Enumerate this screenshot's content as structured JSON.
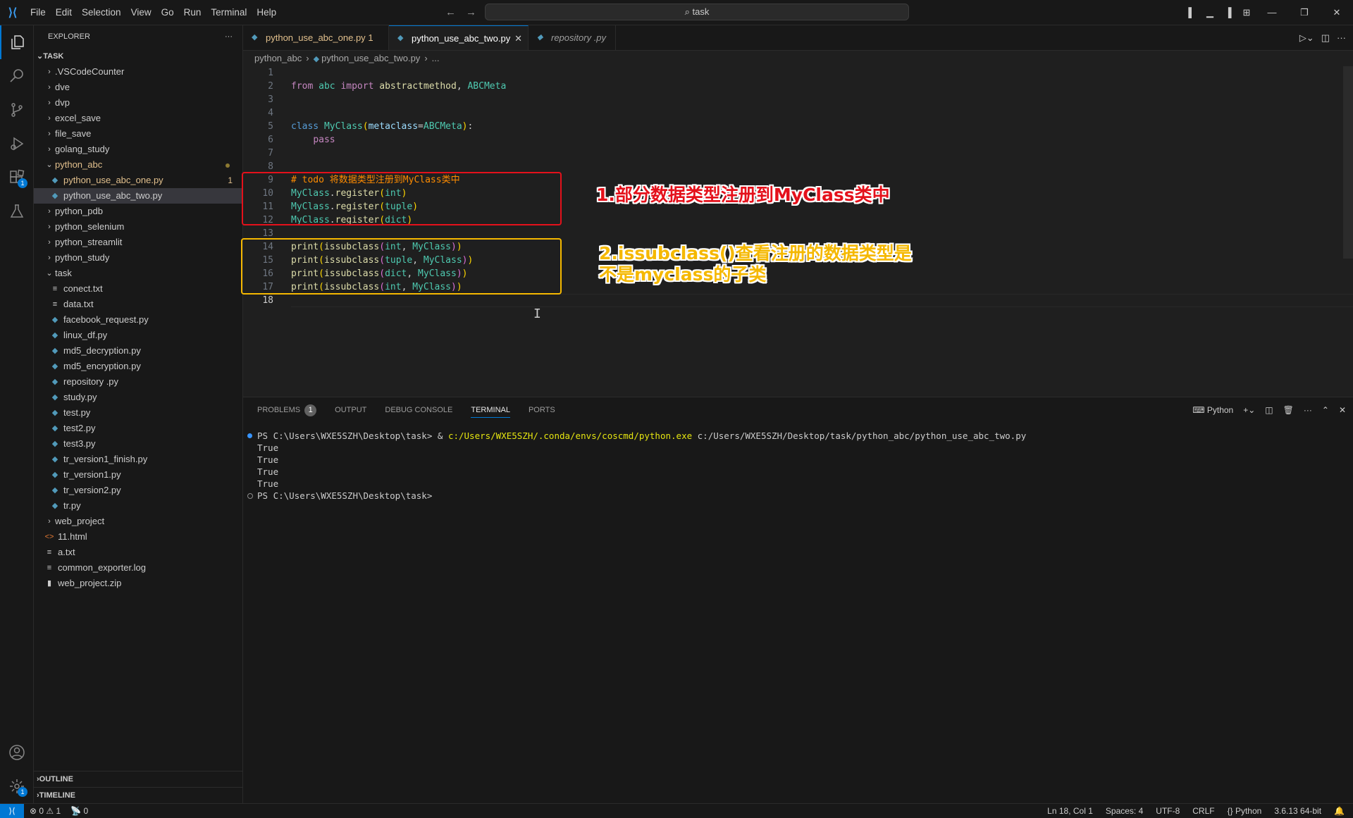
{
  "titlebar": {
    "menu": [
      "File",
      "Edit",
      "Selection",
      "View",
      "Go",
      "Run",
      "Terminal",
      "Help"
    ],
    "search": "task"
  },
  "activity": {
    "extensions_badge": "1",
    "settings_badge": "1"
  },
  "explorer": {
    "title": "EXPLORER",
    "root": "TASK",
    "items": [
      {
        "label": ".VSCodeCounter"
      },
      {
        "label": "dve"
      },
      {
        "label": "dvp"
      },
      {
        "label": "excel_save"
      },
      {
        "label": "file_save"
      },
      {
        "label": "golang_study"
      },
      {
        "label": "python_abc"
      },
      {
        "label": "python_use_abc_one.py",
        "count": "1"
      },
      {
        "label": "python_use_abc_two.py"
      },
      {
        "label": "python_pdb"
      },
      {
        "label": "python_selenium"
      },
      {
        "label": "python_streamlit"
      },
      {
        "label": "python_study"
      },
      {
        "label": "task"
      },
      {
        "label": "conect.txt"
      },
      {
        "label": "data.txt"
      },
      {
        "label": "facebook_request.py"
      },
      {
        "label": "linux_df.py"
      },
      {
        "label": "md5_decryption.py"
      },
      {
        "label": "md5_encryption.py"
      },
      {
        "label": "repository .py"
      },
      {
        "label": "study.py"
      },
      {
        "label": "test.py"
      },
      {
        "label": "test2.py"
      },
      {
        "label": "test3.py"
      },
      {
        "label": "tr_version1_finish.py"
      },
      {
        "label": "tr_version1.py"
      },
      {
        "label": "tr_version2.py"
      },
      {
        "label": "tr.py"
      },
      {
        "label": "web_project"
      },
      {
        "label": "11.html"
      },
      {
        "label": "a.txt"
      },
      {
        "label": "common_exporter.log"
      },
      {
        "label": "web_project.zip"
      }
    ],
    "outline": "OUTLINE",
    "timeline": "TIMELINE"
  },
  "tabs": [
    {
      "label": "python_use_abc_one.py",
      "count": "1"
    },
    {
      "label": "python_use_abc_two.py"
    },
    {
      "label": "repository .py"
    }
  ],
  "breadcrumb": {
    "folder": "python_abc",
    "file": "python_use_abc_two.py",
    "more": "..."
  },
  "editor": {
    "line_numbers": [
      "1",
      "2",
      "3",
      "4",
      "5",
      "6",
      "7",
      "8",
      "9",
      "10",
      "11",
      "12",
      "13",
      "14",
      "15",
      "16",
      "17",
      "18"
    ],
    "tokens": {
      "from": "from",
      "abc": "abc",
      "import": "import",
      "abstractmethod": "abstractmethod",
      "comma": ",",
      "ABCMeta": "ABCMeta",
      "class": "class",
      "MyClass": "MyClass",
      "paren_open": "(",
      "paren_close": ")",
      "metaclass": "metaclass",
      "eq": "=",
      "colon": ":",
      "pass": "pass",
      "comment": "# todo 将数据类型注册到MyClass类中",
      "dot": ".",
      "register": "register",
      "int": "int",
      "tuple": "tuple",
      "dict": "dict",
      "print": "print",
      "issubclass": "issubclass",
      "comma_space": ", "
    }
  },
  "annotations": {
    "red": "1.部分数据类型注册到MyClass类中",
    "yellow_line1": "2.issubclass()查看注册的数据类型是",
    "yellow_line2": "不是myclass的子类"
  },
  "panel": {
    "tabs": [
      "PROBLEMS",
      "OUTPUT",
      "DEBUG CONSOLE",
      "TERMINAL",
      "PORTS"
    ],
    "problems_count": "1",
    "shell": "Python",
    "terminal": {
      "prompt1": "PS C:\\Users\\WXE5SZH\\Desktop\\task> & ",
      "exe": "c:/Users/WXE5SZH/.conda/envs/coscmd/python.exe",
      "arg": " c:/Users/WXE5SZH/Desktop/task/python_abc/python_use_abc_two.py",
      "outputs": [
        "True",
        "True",
        "True",
        "True"
      ],
      "prompt2": "PS C:\\Users\\WXE5SZH\\Desktop\\task>"
    }
  },
  "status": {
    "errors": "0",
    "warnings": "1",
    "ports": "0",
    "position": "Ln 18, Col 1",
    "spaces": "Spaces: 4",
    "encoding": "UTF-8",
    "eol": "CRLF",
    "language": "Python",
    "interpreter": "3.6.13 64-bit"
  }
}
